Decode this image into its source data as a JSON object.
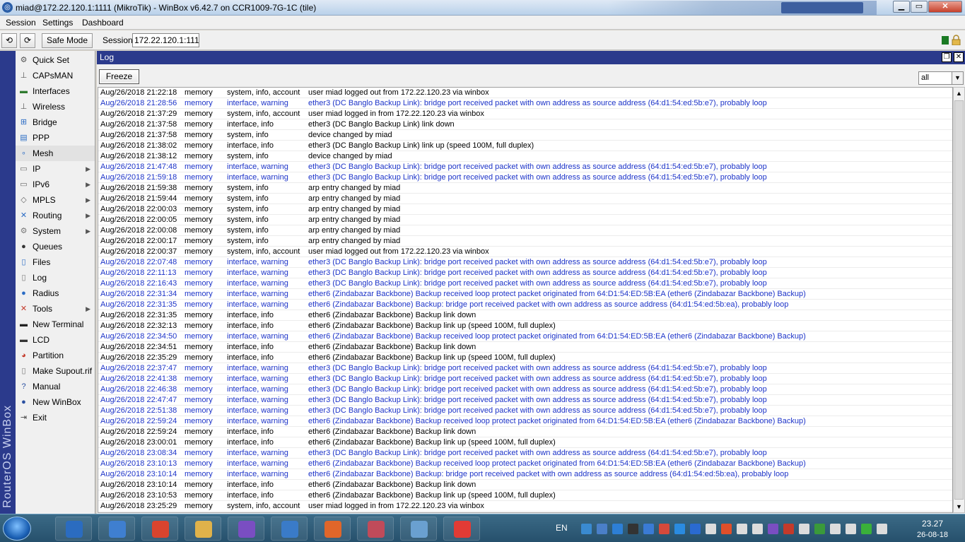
{
  "window": {
    "title": "miad@172.22.120.1:1111 (MikroTik) - WinBox v6.42.7 on CCR1009-7G-1C (tile)"
  },
  "menu": [
    "Session",
    "Settings",
    "Dashboard"
  ],
  "toolbar": {
    "undo": "⟲",
    "redo": "⟳",
    "safe_mode": "Safe Mode",
    "session_label": "Session:",
    "session_value": "172.22.120.1:1111"
  },
  "brand_vertical": "RouterOS WinBox",
  "sidebar": [
    {
      "label": "Quick Set",
      "icon": "quickset-icon",
      "glyph": "⚙",
      "color": "#555555",
      "submenu": false
    },
    {
      "label": "CAPsMAN",
      "icon": "capsman-icon",
      "glyph": "⊥",
      "color": "#555555",
      "submenu": false
    },
    {
      "label": "Interfaces",
      "icon": "interfaces-icon",
      "glyph": "▬",
      "color": "#2f7a2f",
      "submenu": false
    },
    {
      "label": "Wireless",
      "icon": "wireless-icon",
      "glyph": "⊥",
      "color": "#555555",
      "submenu": false
    },
    {
      "label": "Bridge",
      "icon": "bridge-icon",
      "glyph": "⊞",
      "color": "#2a6bc4",
      "submenu": false
    },
    {
      "label": "PPP",
      "icon": "ppp-icon",
      "glyph": "▤",
      "color": "#2a6bc4",
      "submenu": false
    },
    {
      "label": "Mesh",
      "icon": "mesh-icon",
      "glyph": "∘",
      "color": "#2a6bc4",
      "submenu": false
    },
    {
      "label": "IP",
      "icon": "ip-icon",
      "glyph": "▭",
      "color": "#666666",
      "submenu": true
    },
    {
      "label": "IPv6",
      "icon": "ipv6-icon",
      "glyph": "▭",
      "color": "#666666",
      "submenu": true
    },
    {
      "label": "MPLS",
      "icon": "mpls-icon",
      "glyph": "◇",
      "color": "#666666",
      "submenu": true
    },
    {
      "label": "Routing",
      "icon": "routing-icon",
      "glyph": "✕",
      "color": "#2a6bc4",
      "submenu": true
    },
    {
      "label": "System",
      "icon": "system-icon",
      "glyph": "⚙",
      "color": "#777777",
      "submenu": true
    },
    {
      "label": "Queues",
      "icon": "queues-icon",
      "glyph": "●",
      "color": "#333333",
      "submenu": false
    },
    {
      "label": "Files",
      "icon": "files-icon",
      "glyph": "▯",
      "color": "#2a6bc4",
      "submenu": false
    },
    {
      "label": "Log",
      "icon": "log-icon",
      "glyph": "▯",
      "color": "#777777",
      "submenu": false
    },
    {
      "label": "Radius",
      "icon": "radius-icon",
      "glyph": "●",
      "color": "#2a6bc4",
      "submenu": false
    },
    {
      "label": "Tools",
      "icon": "tools-icon",
      "glyph": "✕",
      "color": "#c43a2a",
      "submenu": true
    },
    {
      "label": "New Terminal",
      "icon": "terminal-icon",
      "glyph": "▬",
      "color": "#222222",
      "submenu": false
    },
    {
      "label": "LCD",
      "icon": "lcd-icon",
      "glyph": "▬",
      "color": "#333333",
      "submenu": false
    },
    {
      "label": "Partition",
      "icon": "partition-icon",
      "glyph": "◕",
      "color": "#c43a2a",
      "submenu": false
    },
    {
      "label": "Make Supout.rif",
      "icon": "supout-icon",
      "glyph": "▯",
      "color": "#777777",
      "submenu": false
    },
    {
      "label": "Manual",
      "icon": "manual-icon",
      "glyph": "?",
      "color": "#2a4fa0",
      "submenu": false
    },
    {
      "label": "New WinBox",
      "icon": "winbox-icon",
      "glyph": "●",
      "color": "#2a4fa0",
      "submenu": false
    },
    {
      "label": "Exit",
      "icon": "exit-icon",
      "glyph": "⇥",
      "color": "#444444",
      "submenu": false
    }
  ],
  "log": {
    "title": "Log",
    "freeze": "Freeze",
    "filter": "all",
    "entries": [
      [
        "Aug/26/2018 21:22:18",
        "memory",
        "system, info, account",
        "user miad logged out from 172.22.120.23 via winbox",
        false
      ],
      [
        "Aug/26/2018 21:28:56",
        "memory",
        "interface, warning",
        "ether3 (DC Banglo Backup Link): bridge port received packet with own address as source address (64:d1:54:ed:5b:e7), probably loop",
        true
      ],
      [
        "Aug/26/2018 21:37:29",
        "memory",
        "system, info, account",
        "user miad logged in from 172.22.120.23 via winbox",
        false
      ],
      [
        "Aug/26/2018 21:37:58",
        "memory",
        "interface, info",
        "ether3 (DC Banglo Backup Link) link down",
        false
      ],
      [
        "Aug/26/2018 21:37:58",
        "memory",
        "system, info",
        "device changed by miad",
        false
      ],
      [
        "Aug/26/2018 21:38:02",
        "memory",
        "interface, info",
        "ether3 (DC Banglo Backup Link) link up (speed 100M, full duplex)",
        false
      ],
      [
        "Aug/26/2018 21:38:12",
        "memory",
        "system, info",
        "device changed by miad",
        false
      ],
      [
        "Aug/26/2018 21:47:48",
        "memory",
        "interface, warning",
        "ether3 (DC Banglo Backup Link): bridge port received packet with own address as source address (64:d1:54:ed:5b:e7), probably loop",
        true
      ],
      [
        "Aug/26/2018 21:59:18",
        "memory",
        "interface, warning",
        "ether3 (DC Banglo Backup Link): bridge port received packet with own address as source address (64:d1:54:ed:5b:e7), probably loop",
        true
      ],
      [
        "Aug/26/2018 21:59:38",
        "memory",
        "system, info",
        "arp entry changed by miad",
        false
      ],
      [
        "Aug/26/2018 21:59:44",
        "memory",
        "system, info",
        "arp entry changed by miad",
        false
      ],
      [
        "Aug/26/2018 22:00:03",
        "memory",
        "system, info",
        "arp entry changed by miad",
        false
      ],
      [
        "Aug/26/2018 22:00:05",
        "memory",
        "system, info",
        "arp entry changed by miad",
        false
      ],
      [
        "Aug/26/2018 22:00:08",
        "memory",
        "system, info",
        "arp entry changed by miad",
        false
      ],
      [
        "Aug/26/2018 22:00:17",
        "memory",
        "system, info",
        "arp entry changed by miad",
        false
      ],
      [
        "Aug/26/2018 22:00:37",
        "memory",
        "system, info, account",
        "user miad logged out from 172.22.120.23 via winbox",
        false
      ],
      [
        "Aug/26/2018 22:07:48",
        "memory",
        "interface, warning",
        "ether3 (DC Banglo Backup Link): bridge port received packet with own address as source address (64:d1:54:ed:5b:e7), probably loop",
        true
      ],
      [
        "Aug/26/2018 22:11:13",
        "memory",
        "interface, warning",
        "ether3 (DC Banglo Backup Link): bridge port received packet with own address as source address (64:d1:54:ed:5b:e7), probably loop",
        true
      ],
      [
        "Aug/26/2018 22:16:43",
        "memory",
        "interface, warning",
        "ether3 (DC Banglo Backup Link): bridge port received packet with own address as source address (64:d1:54:ed:5b:e7), probably loop",
        true
      ],
      [
        "Aug/26/2018 22:31:34",
        "memory",
        "interface, warning",
        "ether6 (Zindabazar Backbone) Backup received loop protect packet originated from 64:D1:54:ED:5B:EA (ether6 (Zindabazar Backbone) Backup)",
        true
      ],
      [
        "Aug/26/2018 22:31:35",
        "memory",
        "interface, warning",
        "ether6 (Zindabazar Backbone) Backup: bridge port received packet with own address as source address (64:d1:54:ed:5b:ea), probably loop",
        true
      ],
      [
        "Aug/26/2018 22:31:35",
        "memory",
        "interface, info",
        "ether6 (Zindabazar Backbone) Backup link down",
        false
      ],
      [
        "Aug/26/2018 22:32:13",
        "memory",
        "interface, info",
        "ether6 (Zindabazar Backbone) Backup link up (speed 100M, full duplex)",
        false
      ],
      [
        "Aug/26/2018 22:34:50",
        "memory",
        "interface, warning",
        "ether6 (Zindabazar Backbone) Backup received loop protect packet originated from 64:D1:54:ED:5B:EA (ether6 (Zindabazar Backbone) Backup)",
        true
      ],
      [
        "Aug/26/2018 22:34:51",
        "memory",
        "interface, info",
        "ether6 (Zindabazar Backbone) Backup link down",
        false
      ],
      [
        "Aug/26/2018 22:35:29",
        "memory",
        "interface, info",
        "ether6 (Zindabazar Backbone) Backup link up (speed 100M, full duplex)",
        false
      ],
      [
        "Aug/26/2018 22:37:47",
        "memory",
        "interface, warning",
        "ether3 (DC Banglo Backup Link): bridge port received packet with own address as source address (64:d1:54:ed:5b:e7), probably loop",
        true
      ],
      [
        "Aug/26/2018 22:41:38",
        "memory",
        "interface, warning",
        "ether3 (DC Banglo Backup Link): bridge port received packet with own address as source address (64:d1:54:ed:5b:e7), probably loop",
        true
      ],
      [
        "Aug/26/2018 22:46:38",
        "memory",
        "interface, warning",
        "ether3 (DC Banglo Backup Link): bridge port received packet with own address as source address (64:d1:54:ed:5b:e7), probably loop",
        true
      ],
      [
        "Aug/26/2018 22:47:47",
        "memory",
        "interface, warning",
        "ether3 (DC Banglo Backup Link): bridge port received packet with own address as source address (64:d1:54:ed:5b:e7), probably loop",
        true
      ],
      [
        "Aug/26/2018 22:51:38",
        "memory",
        "interface, warning",
        "ether3 (DC Banglo Backup Link): bridge port received packet with own address as source address (64:d1:54:ed:5b:e7), probably loop",
        true
      ],
      [
        "Aug/26/2018 22:59:24",
        "memory",
        "interface, warning",
        "ether6 (Zindabazar Backbone) Backup received loop protect packet originated from 64:D1:54:ED:5B:EA (ether6 (Zindabazar Backbone) Backup)",
        true
      ],
      [
        "Aug/26/2018 22:59:24",
        "memory",
        "interface, info",
        "ether6 (Zindabazar Backbone) Backup link down",
        false
      ],
      [
        "Aug/26/2018 23:00:01",
        "memory",
        "interface, info",
        "ether6 (Zindabazar Backbone) Backup link up (speed 100M, full duplex)",
        false
      ],
      [
        "Aug/26/2018 23:08:34",
        "memory",
        "interface, warning",
        "ether3 (DC Banglo Backup Link): bridge port received packet with own address as source address (64:d1:54:ed:5b:e7), probably loop",
        true
      ],
      [
        "Aug/26/2018 23:10:13",
        "memory",
        "interface, warning",
        "ether6 (Zindabazar Backbone) Backup received loop protect packet originated from 64:D1:54:ED:5B:EA (ether6 (Zindabazar Backbone) Backup)",
        true
      ],
      [
        "Aug/26/2018 23:10:14",
        "memory",
        "interface, warning",
        "ether6 (Zindabazar Backbone) Backup: bridge port received packet with own address as source address (64:d1:54:ed:5b:ea), probably loop",
        true
      ],
      [
        "Aug/26/2018 23:10:14",
        "memory",
        "interface, info",
        "ether6 (Zindabazar Backbone) Backup link down",
        false
      ],
      [
        "Aug/26/2018 23:10:53",
        "memory",
        "interface, info",
        "ether6 (Zindabazar Backbone) Backup link up (speed 100M, full duplex)",
        false
      ],
      [
        "Aug/26/2018 23:25:29",
        "memory",
        "system, info, account",
        "user miad logged in from 172.22.120.23 via winbox",
        false
      ]
    ]
  },
  "taskbar": {
    "apps": [
      {
        "name": "taskbar-app-cleaner",
        "color": "#2b6cc0"
      },
      {
        "name": "taskbar-app-media",
        "color": "#3f7fd0"
      },
      {
        "name": "taskbar-app-chrome",
        "color": "#d9442e"
      },
      {
        "name": "taskbar-app-explorer",
        "color": "#e0b24a"
      },
      {
        "name": "taskbar-app-viber",
        "color": "#7a4ec2"
      },
      {
        "name": "taskbar-app-phone",
        "color": "#3a7bc8"
      },
      {
        "name": "taskbar-app-firefox",
        "color": "#e0662a"
      },
      {
        "name": "taskbar-app-snipping",
        "color": "#c04b5a"
      },
      {
        "name": "taskbar-app-network",
        "color": "#6aa0d0"
      },
      {
        "name": "taskbar-app-anydesk",
        "color": "#e23b35"
      }
    ],
    "lang": "EN",
    "tray_colors": [
      "#3a8ad0",
      "#4a7fc8",
      "#2d7fd6",
      "#333333",
      "#3a7bd5",
      "#d6493b",
      "#2a8be0",
      "#2a6ad0",
      "#dcdcdc",
      "#e04f2a",
      "#dcdcdc",
      "#dcdcdc",
      "#7a4ec2",
      "#c43a2a",
      "#dcdcdc",
      "#3a9a3a",
      "#dcdcdc",
      "#dcdcdc",
      "#3ab03a",
      "#dcdcdc"
    ],
    "time": "23.27",
    "date": "26-08-18"
  }
}
